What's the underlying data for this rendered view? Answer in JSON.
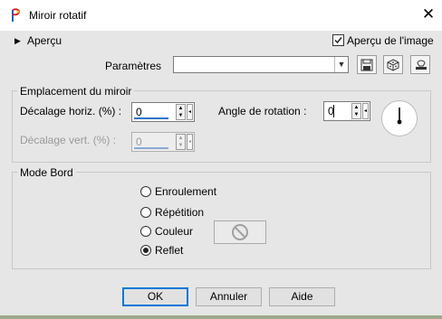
{
  "window": {
    "title": "Miroir rotatif"
  },
  "preview": {
    "label": "Aperçu",
    "show_preview_label": "Aperçu de l'image",
    "show_preview_checked": true
  },
  "presets": {
    "label": "Paramètres",
    "value": ""
  },
  "mirror_group": {
    "legend": "Emplacement du miroir",
    "h_offset": {
      "label": "Décalage horiz. (%) :",
      "value": "0"
    },
    "v_offset": {
      "label": "Décalage vert. (%) :",
      "value": "0"
    },
    "rotation": {
      "label": "Angle de rotation :",
      "value": "0"
    }
  },
  "edge_group": {
    "legend": "Mode Bord",
    "options": [
      {
        "label": "Enroulement",
        "selected": false
      },
      {
        "label": "Répétition",
        "selected": false
      },
      {
        "label": "Couleur",
        "selected": false
      },
      {
        "label": "Reflet",
        "selected": true
      }
    ]
  },
  "buttons": {
    "ok": "OK",
    "cancel": "Annuler",
    "help": "Aide"
  },
  "colors": {
    "accent": "#0078d7",
    "dialog_bg": "#e6e6e6",
    "underline": "#3072c5"
  }
}
